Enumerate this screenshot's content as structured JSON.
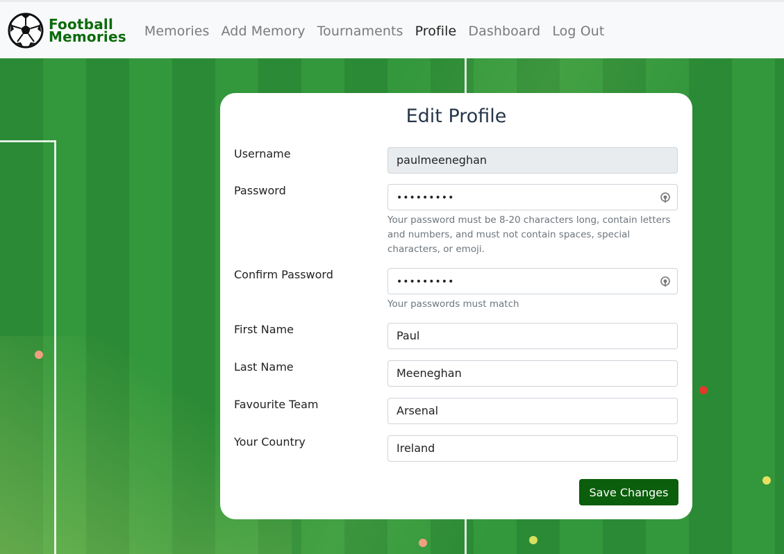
{
  "brand": {
    "line1": "Football",
    "line2": "Memories",
    "color": "#0b6b0b"
  },
  "nav": {
    "items": [
      "Memories",
      "Add Memory",
      "Tournaments",
      "Profile",
      "Dashboard",
      "Log Out"
    ],
    "active": "Profile"
  },
  "form": {
    "title": "Edit Profile",
    "username": {
      "label": "Username",
      "value": "paulmeeneghan"
    },
    "password": {
      "label": "Password",
      "value": "•••••••••",
      "help": "Your password must be 8-20 characters long, contain letters and numbers, and must not contain spaces, special characters, or emoji."
    },
    "confirm_password": {
      "label": "Confirm Password",
      "value": "•••••••••",
      "help": "Your passwords must match"
    },
    "first_name": {
      "label": "First Name",
      "value": "Paul"
    },
    "last_name": {
      "label": "Last Name",
      "value": "Meeneghan"
    },
    "favourite_team": {
      "label": "Favourite Team",
      "value": "Arsenal"
    },
    "country": {
      "label": "Your Country",
      "value": "Ireland"
    },
    "save_label": "Save Changes",
    "save_color": "#0b5e0b"
  },
  "icons": {
    "logo": "football-icon",
    "password_reveal": "eye-icon"
  }
}
